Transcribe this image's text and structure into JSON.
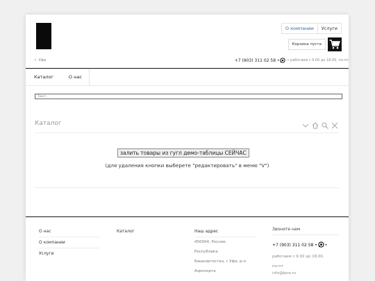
{
  "header": {
    "city": "г. Уфа",
    "top_nav": [
      "О компании",
      "Услуги"
    ],
    "cart_label": "Корзина пуста",
    "phone": "+7 (903) 311 02 58 •",
    "hours": "• работаем с 9.00 до 18.00, пн-пт"
  },
  "menu": [
    "Каталог",
    "О нас"
  ],
  "search": {
    "placeholder": "Текст..."
  },
  "catalog": {
    "title": "Каталог",
    "fill_button": "залить товары из гугл демо-таблицы СЕЙЧАС",
    "hint": "(для удаления кнопки выберете \"редактировать\" в меню \"V\")"
  },
  "footer": {
    "col1": [
      "О нас",
      "О компании",
      "Услуги"
    ],
    "col2": [
      "Каталог"
    ],
    "address_title": "Наш адрес",
    "address_lines": [
      "450004, Россия,",
      "Республика",
      "Башкортостан, г.Уфа, р-н",
      "Аэропорта"
    ],
    "call_title": "Звоните нам",
    "call_phone": "+7 (903) 311 02 58 •",
    "call_phone_tail": "•",
    "call_hours": [
      "работаем с 9.00 до 18.00,",
      "пн-пт"
    ],
    "call_email": "info@tpro.ru"
  },
  "colors": {
    "accent": "#2b6cb0",
    "dark": "#111111",
    "page_bg": "#f0f0f0"
  },
  "icons": [
    "whatsapp-icon",
    "cart-icon",
    "chevron-down-icon",
    "home-icon",
    "search-icon",
    "close-icon"
  ]
}
